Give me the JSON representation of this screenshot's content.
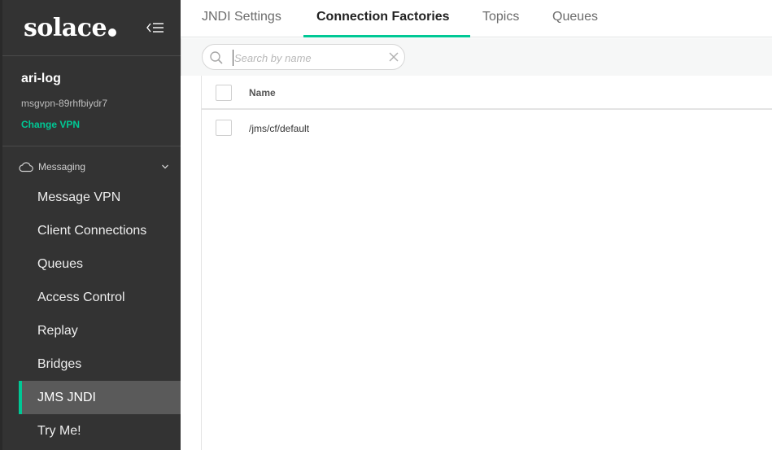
{
  "sidebar": {
    "brand": "solace",
    "vpn": {
      "name": "ari-log",
      "id": "msgvpn-89rhfbiydr7",
      "change_label": "Change VPN"
    },
    "section": {
      "label": "Messaging",
      "icon": "cloud-icon"
    },
    "items": [
      {
        "label": "Message VPN"
      },
      {
        "label": "Client Connections"
      },
      {
        "label": "Queues"
      },
      {
        "label": "Access Control"
      },
      {
        "label": "Replay"
      },
      {
        "label": "Bridges"
      },
      {
        "label": "JMS JNDI",
        "active": true
      },
      {
        "label": "Try Me!"
      }
    ]
  },
  "tabs": [
    {
      "label": "JNDI Settings"
    },
    {
      "label": "Connection Factories",
      "active": true
    },
    {
      "label": "Topics"
    },
    {
      "label": "Queues"
    }
  ],
  "search": {
    "placeholder": "Search by name",
    "value": ""
  },
  "table": {
    "columns": [
      "Name"
    ],
    "rows": [
      {
        "name": "/jms/cf/default"
      }
    ]
  },
  "colors": {
    "accent": "#00c895",
    "sidebar_bg": "#333333",
    "active_item_bg": "#5a5a5a"
  }
}
